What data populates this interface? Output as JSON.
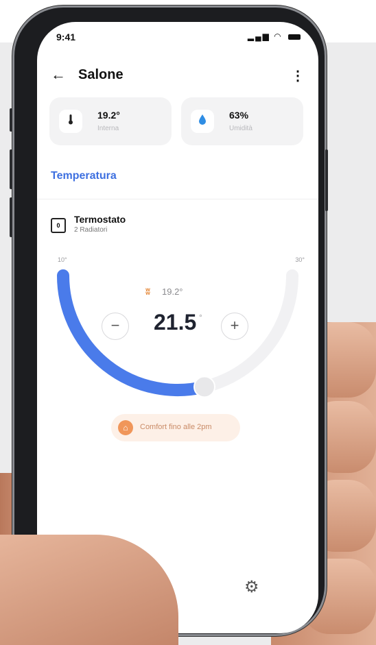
{
  "status": {
    "time": "9:41",
    "signal": "signal-icon",
    "wifi": "wifi-icon",
    "battery": "battery-icon"
  },
  "header": {
    "title": "Salone",
    "back_icon": "arrow-left-icon",
    "menu_icon": "kebab-icon"
  },
  "cards": [
    {
      "value": "19.2°",
      "label": "Interna",
      "icon": "thermometer-icon"
    },
    {
      "value": "63%",
      "label": "Umidità",
      "icon": "droplet-icon"
    }
  ],
  "section": {
    "title": "Temperatura"
  },
  "device": {
    "name": "Termostato",
    "subtitle": "2 Radiatori",
    "icon": "thermostat-icon"
  },
  "dial": {
    "min_label": "10°",
    "max_label": "30°",
    "current_temp": "19.2°",
    "target_temp": "21.5",
    "target_deg": "°",
    "minus_label": "−",
    "plus_label": "+",
    "min_value": 10,
    "max_value": 30,
    "target_value": 21.5,
    "accent": "#4A7BEA",
    "track": "#F1F1F3"
  },
  "badge": {
    "text": "Comfort fino alle 2pm",
    "icon": "home-icon",
    "color": "#F0965A"
  },
  "footer": {
    "settings_icon": "gear-icon"
  }
}
